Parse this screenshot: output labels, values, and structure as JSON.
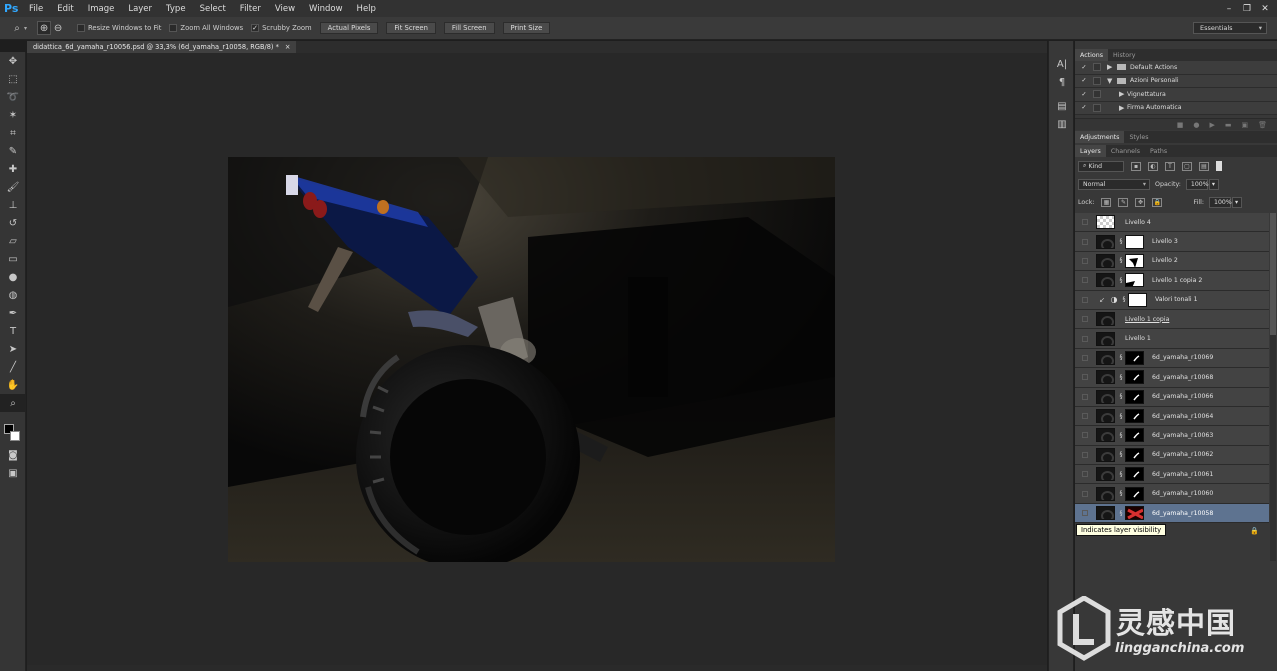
{
  "app": {
    "logo": "Ps",
    "menus": [
      "File",
      "Edit",
      "Image",
      "Layer",
      "Type",
      "Select",
      "Filter",
      "View",
      "Window",
      "Help"
    ],
    "window_controls": [
      "–",
      "❐",
      "✕"
    ]
  },
  "options_bar": {
    "resize_windows_label": "Resize Windows to Fit",
    "zoom_all_label": "Zoom All Windows",
    "scrubby_zoom_label": "Scrubby Zoom",
    "scrubby_checked": "✓",
    "actual_pixels_label": "Actual Pixels",
    "fit_screen_label": "Fit Screen",
    "fill_screen_label": "Fill Screen",
    "print_size_label": "Print Size",
    "workspace_label": "Essentials"
  },
  "document": {
    "tab_title": "didattica_6d_yamaha_r10056.psd @ 33,3% (6d_yamaha_r10058, RGB/8) *",
    "close_glyph": "×"
  },
  "actions_panel": {
    "tabs": [
      "Actions",
      "History"
    ],
    "rows": [
      {
        "check": "✓",
        "arrow": "▶",
        "label": "Default Actions",
        "type": "set",
        "expanded": false
      },
      {
        "check": "✓",
        "arrow": "▼",
        "label": "Azioni Personali",
        "type": "set",
        "expanded": true
      },
      {
        "check": "✓",
        "arrow": "▶",
        "label": "Vignettatura",
        "type": "action"
      },
      {
        "check": "✓",
        "arrow": "▶",
        "label": "Firma Automatica",
        "type": "action"
      }
    ]
  },
  "adjustments_panel": {
    "tabs": [
      "Adjustments",
      "Styles"
    ]
  },
  "layers_panel": {
    "tabs": [
      "Layers",
      "Channels",
      "Paths"
    ],
    "kind_label": "Kind",
    "blend_mode": "Normal",
    "opacity_label": "Opacity:",
    "opacity_value": "100%",
    "lock_label": "Lock:",
    "fill_label": "Fill:",
    "fill_value": "100%",
    "layers": [
      {
        "name": "Livello 4",
        "thumb": "checker",
        "mask": "none"
      },
      {
        "name": "Livello 3",
        "thumb": "photo",
        "mask": "white"
      },
      {
        "name": "Livello 2",
        "thumb": "photo",
        "mask": "white"
      },
      {
        "name": "Livello 1 copia 2",
        "thumb": "photo",
        "mask": "white"
      },
      {
        "name": "Valori tonali 1",
        "thumb": "adjust",
        "mask": "white"
      },
      {
        "name": "Livello 1 copia",
        "thumb": "photo",
        "mask": "none",
        "underline": true
      },
      {
        "name": "Livello 1",
        "thumb": "photo",
        "mask": "none"
      },
      {
        "name": "6d_yamaha_r10069",
        "thumb": "photo",
        "mask": "black"
      },
      {
        "name": "6d_yamaha_r10068",
        "thumb": "photo",
        "mask": "black"
      },
      {
        "name": "6d_yamaha_r10066",
        "thumb": "photo",
        "mask": "black"
      },
      {
        "name": "6d_yamaha_r10064",
        "thumb": "photo",
        "mask": "black"
      },
      {
        "name": "6d_yamaha_r10063",
        "thumb": "photo",
        "mask": "black"
      },
      {
        "name": "6d_yamaha_r10062",
        "thumb": "photo",
        "mask": "black"
      },
      {
        "name": "6d_yamaha_r10061",
        "thumb": "photo",
        "mask": "black"
      },
      {
        "name": "6d_yamaha_r10060",
        "thumb": "photo",
        "mask": "black"
      },
      {
        "name": "6d_yamaha_r10058",
        "thumb": "photo",
        "mask": "red",
        "selected": true
      }
    ]
  },
  "tooltip": {
    "text": "Indicates layer visibility"
  },
  "watermark": {
    "cn": "灵感中国",
    "url": "lingganchina.com"
  },
  "colors": {
    "ps_blue": "#31a8ff",
    "selected_layer": "#5e7390",
    "tooltip_bg": "#ffffe1"
  }
}
